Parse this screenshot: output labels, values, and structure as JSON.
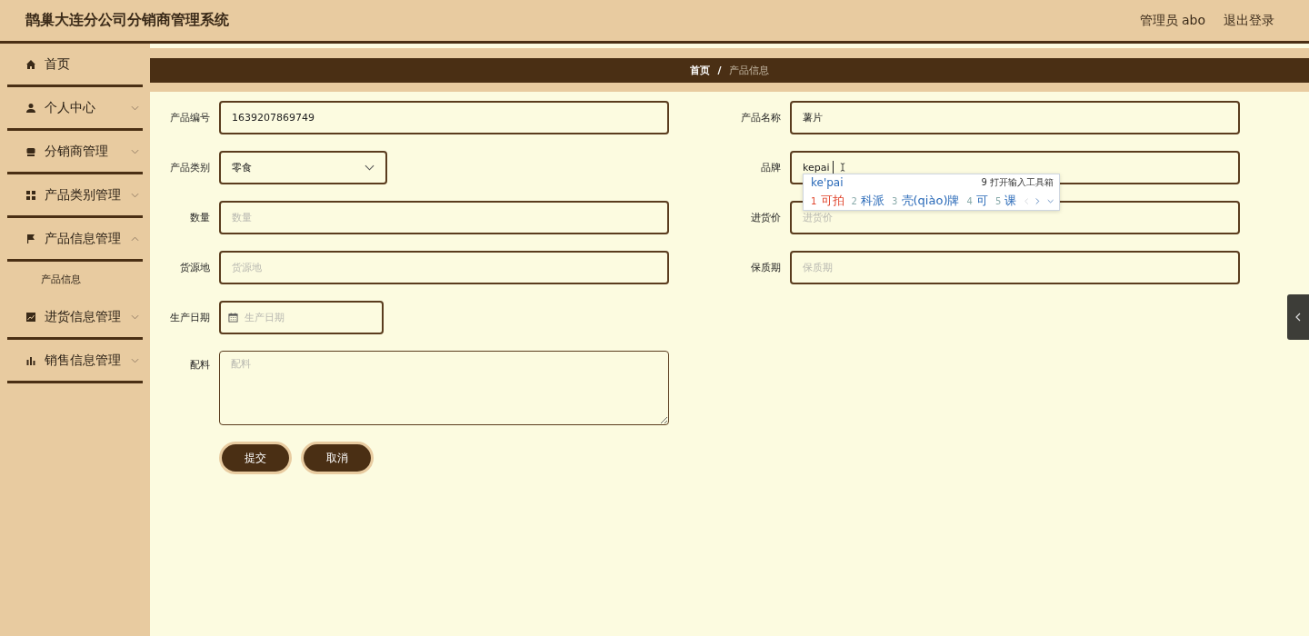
{
  "header": {
    "title": "鹊巢大连分公司分销商管理系统",
    "user": "管理员 abo",
    "logout": "退出登录"
  },
  "sidebar": {
    "items": [
      {
        "label": "首页",
        "kind": "link"
      },
      {
        "label": "个人中心",
        "kind": "menu",
        "expanded": false
      },
      {
        "label": "分销商管理",
        "kind": "menu",
        "expanded": false
      },
      {
        "label": "产品类别管理",
        "kind": "menu",
        "expanded": false
      },
      {
        "label": "产品信息管理",
        "kind": "menu",
        "expanded": true,
        "children": [
          {
            "label": "产品信息"
          }
        ]
      },
      {
        "label": "进货信息管理",
        "kind": "menu",
        "expanded": false
      },
      {
        "label": "销售信息管理",
        "kind": "menu",
        "expanded": false
      }
    ]
  },
  "breadcrumb": {
    "home": "首页",
    "separator": "/",
    "current": "产品信息"
  },
  "form": {
    "fields": [
      {
        "label": "产品编号",
        "kind": "text",
        "value": "1639207869749"
      },
      {
        "label": "产品名称",
        "kind": "text",
        "value": "薯片"
      },
      {
        "label": "产品类别",
        "kind": "select",
        "value": "零食"
      },
      {
        "label": "品牌",
        "kind": "text",
        "value": "kepai",
        "focused": true
      },
      {
        "label": "数量",
        "kind": "text",
        "placeholder": "数量"
      },
      {
        "label": "进货价",
        "kind": "text",
        "placeholder": "进货价"
      },
      {
        "label": "货源地",
        "kind": "text",
        "placeholder": "货源地"
      },
      {
        "label": "保质期",
        "kind": "text",
        "placeholder": "保质期"
      },
      {
        "label": "生产日期",
        "kind": "date",
        "placeholder": "生产日期"
      },
      {
        "label": "配料",
        "kind": "textarea",
        "placeholder": "配料"
      }
    ],
    "buttons": [
      "提交",
      "取消"
    ]
  },
  "ime": {
    "composition": "ke'pai",
    "toolbox": "9 打开输入工具箱",
    "candidates": [
      {
        "index": "1",
        "text": "可拍",
        "selected": true
      },
      {
        "index": "2",
        "text": "科派",
        "selected": false
      },
      {
        "index": "3",
        "text": "壳(qiào)牌",
        "selected": false
      },
      {
        "index": "4",
        "text": "可",
        "selected": false
      },
      {
        "index": "5",
        "text": "课",
        "selected": false
      }
    ]
  }
}
